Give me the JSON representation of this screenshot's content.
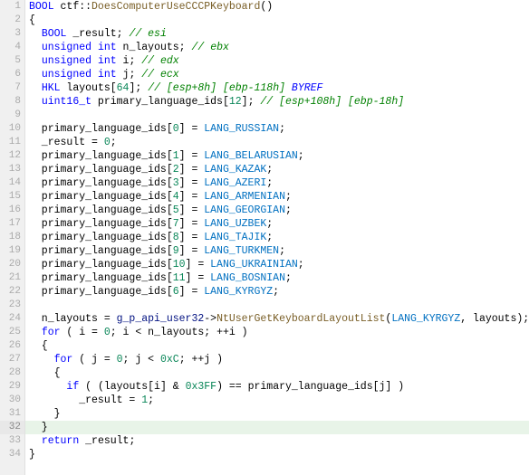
{
  "code": {
    "lines": [
      {
        "num": 1,
        "highlight": false,
        "tokens": [
          {
            "t": "BOOL ctf::DoesComputerUseCCCPKeyboard()",
            "c": "plain"
          }
        ]
      },
      {
        "num": 2,
        "highlight": false,
        "tokens": [
          {
            "t": "{",
            "c": "plain"
          }
        ]
      },
      {
        "num": 3,
        "highlight": false,
        "tokens": [
          {
            "t": "  BOOL _result; // esi",
            "c": ""
          }
        ]
      },
      {
        "num": 4,
        "highlight": false,
        "tokens": [
          {
            "t": "  unsigned int n_layouts; // ebx",
            "c": ""
          }
        ]
      },
      {
        "num": 5,
        "highlight": false,
        "tokens": [
          {
            "t": "  unsigned int i; // edx",
            "c": ""
          }
        ]
      },
      {
        "num": 6,
        "highlight": false,
        "tokens": [
          {
            "t": "  unsigned int j; // ecx",
            "c": ""
          }
        ]
      },
      {
        "num": 7,
        "highlight": false,
        "tokens": [
          {
            "t": "  HKL layouts[64]; // [esp+8h] [ebp-118h] BYREF",
            "c": ""
          }
        ]
      },
      {
        "num": 8,
        "highlight": false,
        "tokens": [
          {
            "t": "  uint16_t primary_language_ids[12]; // [esp+108h] [ebp-18h]",
            "c": ""
          }
        ]
      },
      {
        "num": 9,
        "highlight": false,
        "tokens": [
          {
            "t": "",
            "c": ""
          }
        ]
      },
      {
        "num": 10,
        "highlight": false,
        "tokens": [
          {
            "t": "  primary_language_ids[0] = LANG_RUSSIAN;",
            "c": ""
          }
        ]
      },
      {
        "num": 11,
        "highlight": false,
        "tokens": [
          {
            "t": "  _result = 0;",
            "c": ""
          }
        ]
      },
      {
        "num": 12,
        "highlight": false,
        "tokens": [
          {
            "t": "  primary_language_ids[1] = LANG_BELARUSIAN;",
            "c": ""
          }
        ]
      },
      {
        "num": 13,
        "highlight": false,
        "tokens": [
          {
            "t": "  primary_language_ids[2] = LANG_KAZAK;",
            "c": ""
          }
        ]
      },
      {
        "num": 14,
        "highlight": false,
        "tokens": [
          {
            "t": "  primary_language_ids[3] = LANG_AZERI;",
            "c": ""
          }
        ]
      },
      {
        "num": 15,
        "highlight": false,
        "tokens": [
          {
            "t": "  primary_language_ids[4] = LANG_ARMENIAN;",
            "c": ""
          }
        ]
      },
      {
        "num": 16,
        "highlight": false,
        "tokens": [
          {
            "t": "  primary_language_ids[5] = LANG_GEORGIAN;",
            "c": ""
          }
        ]
      },
      {
        "num": 17,
        "highlight": false,
        "tokens": [
          {
            "t": "  primary_language_ids[7] = LANG_UZBEK;",
            "c": ""
          }
        ]
      },
      {
        "num": 18,
        "highlight": false,
        "tokens": [
          {
            "t": "  primary_language_ids[8] = LANG_TAJIK;",
            "c": ""
          }
        ]
      },
      {
        "num": 19,
        "highlight": false,
        "tokens": [
          {
            "t": "  primary_language_ids[9] = LANG_TURKMEN;",
            "c": ""
          }
        ]
      },
      {
        "num": 20,
        "highlight": false,
        "tokens": [
          {
            "t": "  primary_language_ids[10] = LANG_UKRAINIAN;",
            "c": ""
          }
        ]
      },
      {
        "num": 21,
        "highlight": false,
        "tokens": [
          {
            "t": "  primary_language_ids[11] = LANG_BOSNIAN;",
            "c": ""
          }
        ]
      },
      {
        "num": 22,
        "highlight": false,
        "tokens": [
          {
            "t": "  primary_language_ids[6] = LANG_KYRGYZ;",
            "c": ""
          }
        ]
      },
      {
        "num": 23,
        "highlight": false,
        "tokens": [
          {
            "t": "",
            "c": ""
          }
        ]
      },
      {
        "num": 24,
        "highlight": false,
        "tokens": [
          {
            "t": "  n_layouts = g_p_api_user32->NtUserGetKeyboardLayoutList(LANG_KYRGYZ, layouts);",
            "c": ""
          }
        ]
      },
      {
        "num": 25,
        "highlight": false,
        "tokens": [
          {
            "t": "  for ( i = 0; i < n_layouts; ++i )",
            "c": ""
          }
        ]
      },
      {
        "num": 26,
        "highlight": false,
        "tokens": [
          {
            "t": "  {",
            "c": ""
          }
        ]
      },
      {
        "num": 27,
        "highlight": false,
        "tokens": [
          {
            "t": "    for ( j = 0; j < 0xC; ++j )",
            "c": ""
          }
        ]
      },
      {
        "num": 28,
        "highlight": false,
        "tokens": [
          {
            "t": "    {",
            "c": ""
          }
        ]
      },
      {
        "num": 29,
        "highlight": false,
        "tokens": [
          {
            "t": "      if ( (layouts[i] & 0x3FF) == primary_language_ids[j] )",
            "c": ""
          }
        ]
      },
      {
        "num": 30,
        "highlight": false,
        "tokens": [
          {
            "t": "        _result = 1;",
            "c": ""
          }
        ]
      },
      {
        "num": 31,
        "highlight": false,
        "tokens": [
          {
            "t": "    }",
            "c": ""
          }
        ]
      },
      {
        "num": 32,
        "highlight": true,
        "tokens": [
          {
            "t": "  }",
            "c": ""
          }
        ]
      },
      {
        "num": 33,
        "highlight": false,
        "tokens": [
          {
            "t": "  return _result;",
            "c": ""
          }
        ]
      },
      {
        "num": 34,
        "highlight": false,
        "tokens": [
          {
            "t": "}",
            "c": ""
          }
        ]
      }
    ]
  }
}
